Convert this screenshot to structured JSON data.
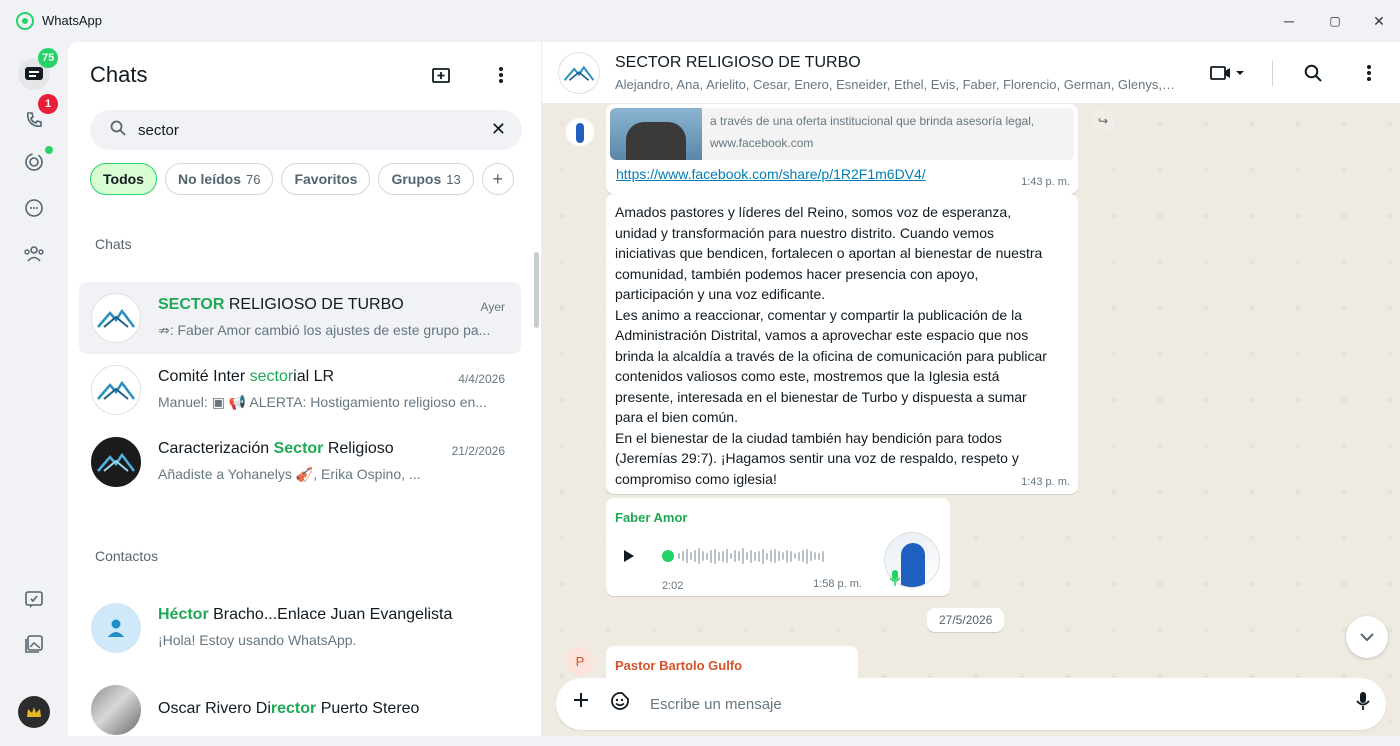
{
  "app": {
    "title": "WhatsApp"
  },
  "window": {
    "minimize": "─",
    "restore": "▢",
    "close": "✕"
  },
  "rail": {
    "chats_badge": "75",
    "calls_badge": "1",
    "icons": [
      "chats-icon",
      "calls-icon",
      "status-icon",
      "channels-icon",
      "communities-icon",
      "starred-icon",
      "archive-icon",
      "profile-avatar"
    ]
  },
  "chatlist": {
    "title": "Chats",
    "search_value": "sector",
    "filters": [
      {
        "label": "Todos",
        "count": ""
      },
      {
        "label": "No leídos",
        "count": "76"
      },
      {
        "label": "Favoritos",
        "count": ""
      },
      {
        "label": "Grupos",
        "count": "13"
      },
      {
        "label": "+",
        "count": ""
      }
    ],
    "section_chats": "Chats",
    "section_contacts": "Contactos",
    "rows": [
      {
        "pre": "",
        "hl": "SECTOR",
        "post": " RELIGIOSO DE TURBO",
        "time": "Ayer",
        "msg": "⇏: Faber Amor cambió los ajustes de este grupo pa..."
      },
      {
        "pre": "Comité Inter ",
        "hl": "sector",
        "post": "ial LR",
        "time": "4/4/2026",
        "msg": "Manuel: ▣ 📢 ALERTA: Hostigamiento religioso en..."
      },
      {
        "pre": "Caracterización ",
        "hl": "Sector",
        "post": " Religioso",
        "time": "21/2/2026",
        "msg": "Añadiste a Yohanelys 🎻, Erika Ospino, ..."
      }
    ],
    "contacts": [
      {
        "pre": "",
        "hl": "Héctor",
        "post": " Bracho...Enlace Juan Evangelista",
        "msg": "¡Hola! Estoy usando WhatsApp."
      },
      {
        "pre": "Oscar Rivero Di",
        "hl": "rector",
        "post": " Puerto Stereo",
        "msg": ""
      }
    ]
  },
  "conversation": {
    "group_name": "SECTOR RELIGIOSO DE TURBO",
    "members": "Alejandro, Ana, Arielito, Cesar, Enero, Esneider, Ethel, Evis, Faber, Florencio, German, Glenys, G...",
    "preview_desc": "a través de una oferta institucional que brinda asesoría legal,",
    "preview_domain": "www.facebook.com",
    "link": "https://www.facebook.com/share/p/1R2F1m6DV4/",
    "link_time": "1:43 p. m.",
    "long_msg": "Amados pastores y líderes del Reino, somos voz de esperanza,\nunidad y transformación para nuestro distrito. Cuando vemos\niniciativas que bendicen, fortalecen o aportan al bienestar de nuestra\ncomunidad, también podemos hacer presencia con apoyo,\nparticipación y una voz edificante.\nLes animo a reaccionar, comentar y compartir la publicación de la\nAdministración Distrital, vamos a aprovechar este espacio que nos\nbrinda la alcaldía a través de la oficina de comunicación para publicar\ncontenidos valiosos como este, mostremos que la Iglesia está\npresente, interesada en el bienestar de Turbo y dispuesta a sumar\npara el bien común.\nEn el bienestar de la ciudad también hay bendición para todos\n(Jeremías 29:7). ¡Hagamos sentir una voz de respaldo, respeto y\ncompromiso como iglesia!",
    "long_time": "1:43 p. m.",
    "voice_sender": "Faber Amor",
    "voice_duration": "2:02",
    "voice_time": "1:58 p. m.",
    "date_pill": "27/5/2026",
    "last_sender": "Pastor Bartolo Gulfo",
    "last_avatar_letter": "P",
    "composer_placeholder": "Escribe un mensaje"
  }
}
